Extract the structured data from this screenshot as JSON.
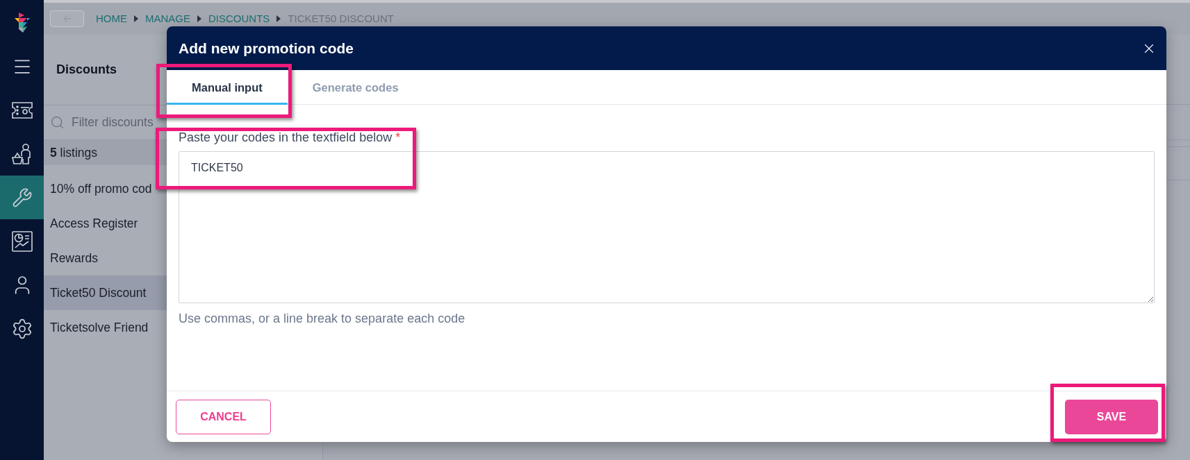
{
  "nav": [
    {
      "selected": false
    },
    {
      "selected": false
    },
    {
      "selected": true
    },
    {
      "selected": false
    },
    {
      "selected": false
    },
    {
      "selected": false
    }
  ],
  "breadcrumb": [
    {
      "label": "HOME",
      "current": false
    },
    {
      "label": "MANAGE",
      "current": false
    },
    {
      "label": "DISCOUNTS",
      "current": false
    },
    {
      "label": "TICKET50 DISCOUNT",
      "current": true
    }
  ],
  "list_panel": {
    "title": "Discounts",
    "filter": {
      "placeholder": "Filter discounts"
    },
    "count": "**5** listings",
    "items": [
      {
        "label": "10% off promo cod",
        "selected": false
      },
      {
        "label": "Access Register",
        "selected": false
      },
      {
        "label": "Rewards",
        "selected": false
      },
      {
        "label": "Ticket50 Discount",
        "selected": true
      },
      {
        "label": "Ticketsolve Friend",
        "selected": false
      }
    ]
  },
  "modal": {
    "title": "Add new promotion code",
    "tabs": [
      {
        "label": "Manual input",
        "selected": true,
        "highlighted": true
      },
      {
        "label": "Generate codes",
        "selected": false,
        "highlighted": false
      }
    ],
    "field": {
      "label": "Paste your codes in the textfield below",
      "required_mark": "*",
      "value": "TICKET50",
      "hint": "Use commas, or a line break to separate each code",
      "highlighted": true
    },
    "buttons": [
      {
        "label": "CANCEL",
        "kind": "secondary",
        "highlighted": false
      },
      {
        "label": "SAVE",
        "kind": "primary",
        "highlighted": true
      }
    ]
  }
}
